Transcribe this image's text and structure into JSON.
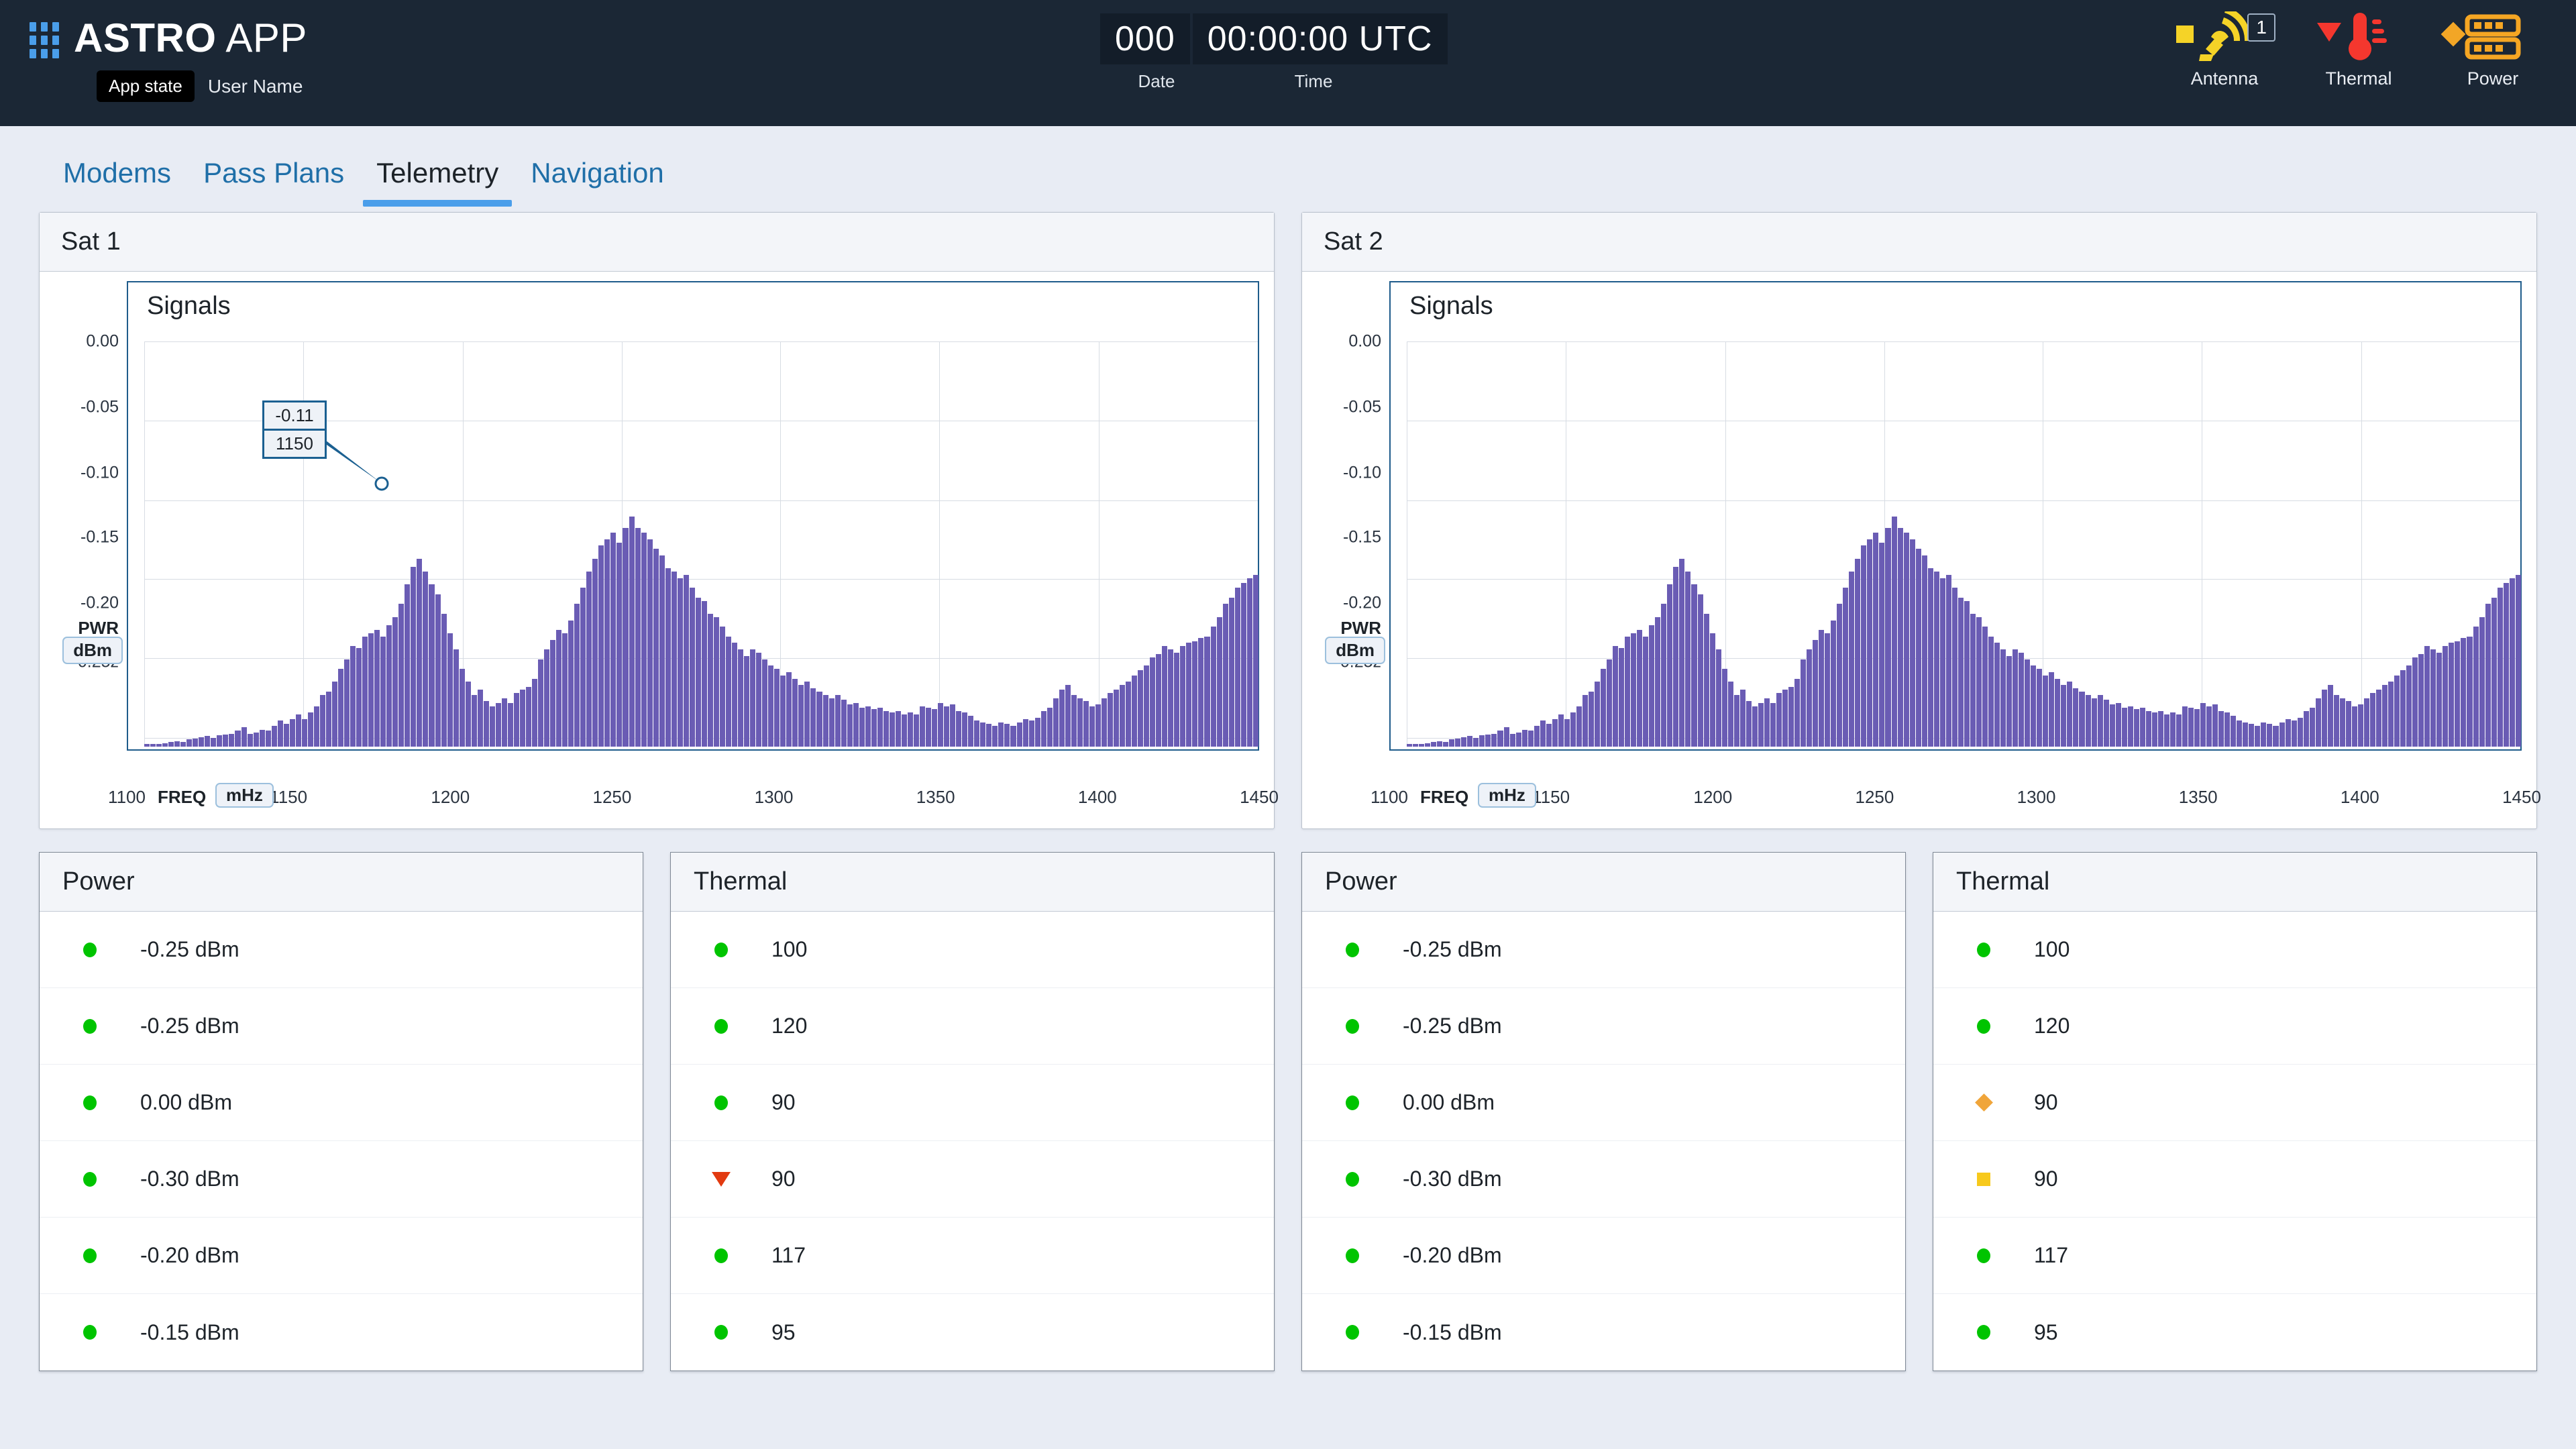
{
  "header": {
    "app_title_bold": "ASTRO",
    "app_title_light": "APP",
    "app_state": "App state",
    "user_name": "User Name",
    "date_value": "000",
    "time_value": "00:00:00 UTC",
    "date_label": "Date",
    "time_label": "Time",
    "status": [
      {
        "name": "Antenna",
        "severity": "square",
        "severity_color": "#f5d327",
        "badge": "1"
      },
      {
        "name": "Thermal",
        "severity": "triangle",
        "severity_color": "#f4372e",
        "badge": ""
      },
      {
        "name": "Power",
        "severity": "diamond",
        "severity_color": "#f2a626",
        "badge": ""
      }
    ]
  },
  "tabs": [
    {
      "label": "Modems",
      "active": false
    },
    {
      "label": "Pass Plans",
      "active": false
    },
    {
      "label": "Telemetry",
      "active": true
    },
    {
      "label": "Navigation",
      "active": false
    }
  ],
  "chart_data": [
    {
      "type": "bar",
      "panel_title": "Sat 1",
      "title": "Signals",
      "xlabel": "FREQ",
      "xunit": "mHz",
      "ylabel": "PWR",
      "yunit": "dBm",
      "xticks": [
        1100,
        1150,
        1200,
        1250,
        1300,
        1350,
        1400,
        1450
      ],
      "yticks": [
        "0.00",
        "-0.05",
        "-0.10",
        "-0.15",
        "-0.20",
        "-0.25z"
      ],
      "ylim": [
        -0.25,
        0.0
      ],
      "xlim": [
        1100,
        1450
      ],
      "grid": true,
      "tooltip": {
        "value": "-0.11",
        "freq": "1150"
      },
      "values": [
        -0.249,
        -0.2488,
        -0.2486,
        -0.248,
        -0.247,
        -0.2465,
        -0.247,
        -0.2455,
        -0.245,
        -0.244,
        -0.2435,
        -0.2445,
        -0.243,
        -0.2425,
        -0.242,
        -0.24,
        -0.238,
        -0.242,
        -0.2415,
        -0.2395,
        -0.24,
        -0.237,
        -0.234,
        -0.236,
        -0.233,
        -0.23,
        -0.233,
        -0.229,
        -0.225,
        -0.218,
        -0.216,
        -0.21,
        -0.202,
        -0.196,
        -0.188,
        -0.189,
        -0.182,
        -0.18,
        -0.178,
        -0.182,
        -0.175,
        -0.17,
        -0.162,
        -0.15,
        -0.139,
        -0.134,
        -0.142,
        -0.15,
        -0.156,
        -0.168,
        -0.18,
        -0.19,
        -0.202,
        -0.21,
        -0.218,
        -0.215,
        -0.222,
        -0.225,
        -0.223,
        -0.22,
        -0.223,
        -0.217,
        -0.215,
        -0.213,
        -0.208,
        -0.196,
        -0.19,
        -0.184,
        -0.178,
        -0.18,
        -0.172,
        -0.162,
        -0.152,
        -0.142,
        -0.134,
        -0.126,
        -0.122,
        -0.118,
        -0.124,
        -0.115,
        -0.108,
        -0.115,
        -0.118,
        -0.122,
        -0.128,
        -0.132,
        -0.14,
        -0.142,
        -0.146,
        -0.144,
        -0.152,
        -0.158,
        -0.16,
        -0.168,
        -0.17,
        -0.176,
        -0.182,
        -0.186,
        -0.19,
        -0.194,
        -0.19,
        -0.192,
        -0.196,
        -0.2,
        -0.202,
        -0.206,
        -0.204,
        -0.208,
        -0.212,
        -0.21,
        -0.214,
        -0.216,
        -0.218,
        -0.22,
        -0.218,
        -0.221,
        -0.224,
        -0.223,
        -0.226,
        -0.225,
        -0.227,
        -0.226,
        -0.228,
        -0.229,
        -0.228,
        -0.23,
        -0.229,
        -0.23,
        -0.225,
        -0.226,
        -0.227,
        -0.223,
        -0.225,
        -0.224,
        -0.228,
        -0.229,
        -0.231,
        -0.234,
        -0.235,
        -0.236,
        -0.237,
        -0.235,
        -0.236,
        -0.237,
        -0.235,
        -0.233,
        -0.234,
        -0.232,
        -0.228,
        -0.226,
        -0.22,
        -0.215,
        -0.212,
        -0.218,
        -0.22,
        -0.222,
        -0.225,
        -0.224,
        -0.22,
        -0.217,
        -0.215,
        -0.212,
        -0.21,
        -0.206,
        -0.203,
        -0.2,
        -0.195,
        -0.193,
        -0.188,
        -0.19,
        -0.192,
        -0.188,
        -0.186,
        -0.185,
        -0.183,
        -0.182,
        -0.176,
        -0.17,
        -0.162,
        -0.158,
        -0.152,
        -0.149,
        -0.146,
        -0.144
      ]
    },
    {
      "type": "bar",
      "panel_title": "Sat 2",
      "title": "Signals",
      "xlabel": "FREQ",
      "xunit": "mHz",
      "ylabel": "PWR",
      "yunit": "dBm",
      "xticks": [
        1100,
        1150,
        1200,
        1250,
        1300,
        1350,
        1400,
        1450
      ],
      "yticks": [
        "0.00",
        "-0.05",
        "-0.10",
        "-0.15",
        "-0.20",
        "-0.25z"
      ],
      "ylim": [
        -0.25,
        0.0
      ],
      "xlim": [
        1100,
        1450
      ],
      "grid": true,
      "tooltip": null,
      "values": [
        -0.249,
        -0.2488,
        -0.2486,
        -0.248,
        -0.247,
        -0.2465,
        -0.247,
        -0.2455,
        -0.245,
        -0.244,
        -0.2435,
        -0.2445,
        -0.243,
        -0.2425,
        -0.242,
        -0.24,
        -0.238,
        -0.242,
        -0.2415,
        -0.2395,
        -0.24,
        -0.237,
        -0.234,
        -0.236,
        -0.233,
        -0.23,
        -0.233,
        -0.229,
        -0.225,
        -0.218,
        -0.216,
        -0.21,
        -0.202,
        -0.196,
        -0.188,
        -0.189,
        -0.182,
        -0.18,
        -0.178,
        -0.182,
        -0.175,
        -0.17,
        -0.162,
        -0.15,
        -0.139,
        -0.134,
        -0.142,
        -0.15,
        -0.156,
        -0.168,
        -0.18,
        -0.19,
        -0.202,
        -0.21,
        -0.218,
        -0.215,
        -0.222,
        -0.225,
        -0.223,
        -0.22,
        -0.223,
        -0.217,
        -0.215,
        -0.213,
        -0.208,
        -0.196,
        -0.19,
        -0.184,
        -0.178,
        -0.18,
        -0.172,
        -0.162,
        -0.152,
        -0.142,
        -0.134,
        -0.126,
        -0.122,
        -0.118,
        -0.124,
        -0.115,
        -0.108,
        -0.115,
        -0.118,
        -0.122,
        -0.128,
        -0.132,
        -0.14,
        -0.142,
        -0.146,
        -0.144,
        -0.152,
        -0.158,
        -0.16,
        -0.168,
        -0.17,
        -0.176,
        -0.182,
        -0.186,
        -0.19,
        -0.194,
        -0.19,
        -0.192,
        -0.196,
        -0.2,
        -0.202,
        -0.206,
        -0.204,
        -0.208,
        -0.212,
        -0.21,
        -0.214,
        -0.216,
        -0.218,
        -0.22,
        -0.218,
        -0.221,
        -0.224,
        -0.223,
        -0.226,
        -0.225,
        -0.227,
        -0.226,
        -0.228,
        -0.229,
        -0.228,
        -0.23,
        -0.229,
        -0.23,
        -0.225,
        -0.226,
        -0.227,
        -0.223,
        -0.225,
        -0.224,
        -0.228,
        -0.229,
        -0.231,
        -0.234,
        -0.235,
        -0.236,
        -0.237,
        -0.235,
        -0.236,
        -0.237,
        -0.235,
        -0.233,
        -0.234,
        -0.232,
        -0.228,
        -0.226,
        -0.22,
        -0.215,
        -0.212,
        -0.218,
        -0.22,
        -0.222,
        -0.225,
        -0.224,
        -0.22,
        -0.217,
        -0.215,
        -0.212,
        -0.21,
        -0.206,
        -0.203,
        -0.2,
        -0.195,
        -0.193,
        -0.188,
        -0.19,
        -0.192,
        -0.188,
        -0.186,
        -0.185,
        -0.183,
        -0.182,
        -0.176,
        -0.17,
        -0.162,
        -0.158,
        -0.152,
        -0.149,
        -0.146,
        -0.144
      ]
    }
  ],
  "tables": [
    {
      "title": "Power",
      "rows": [
        {
          "status": "circle",
          "value": "-0.25 dBm"
        },
        {
          "status": "circle",
          "value": "-0.25 dBm"
        },
        {
          "status": "circle",
          "value": "0.00 dBm"
        },
        {
          "status": "circle",
          "value": "-0.30 dBm"
        },
        {
          "status": "circle",
          "value": "-0.20 dBm"
        },
        {
          "status": "circle",
          "value": "-0.15 dBm"
        }
      ]
    },
    {
      "title": "Thermal",
      "rows": [
        {
          "status": "circle",
          "value": "100"
        },
        {
          "status": "circle",
          "value": "120"
        },
        {
          "status": "circle",
          "value": "90"
        },
        {
          "status": "triangle",
          "value": "90"
        },
        {
          "status": "circle",
          "value": "117"
        },
        {
          "status": "circle",
          "value": "95"
        }
      ]
    },
    {
      "title": "Power",
      "rows": [
        {
          "status": "circle",
          "value": "-0.25 dBm"
        },
        {
          "status": "circle",
          "value": "-0.25 dBm"
        },
        {
          "status": "circle",
          "value": "0.00 dBm"
        },
        {
          "status": "circle",
          "value": "-0.30 dBm"
        },
        {
          "status": "circle",
          "value": "-0.20 dBm"
        },
        {
          "status": "circle",
          "value": "-0.15 dBm"
        }
      ]
    },
    {
      "title": "Thermal",
      "rows": [
        {
          "status": "circle",
          "value": "100"
        },
        {
          "status": "circle",
          "value": "120"
        },
        {
          "status": "diamond",
          "value": "90"
        },
        {
          "status": "square",
          "value": "90"
        },
        {
          "status": "circle",
          "value": "117"
        },
        {
          "status": "circle",
          "value": "95"
        }
      ]
    }
  ],
  "colors": {
    "header_bg": "#1b2735",
    "page_bg": "#e8ecf4",
    "accent": "#4a9eea",
    "link": "#1f6fa8",
    "bar": "#6a5cb4",
    "plot_border": "#1f5c8b",
    "ok": "#00c400",
    "warn": "#f7c91c",
    "caution": "#f0a53a",
    "alarm": "#e23a10"
  }
}
